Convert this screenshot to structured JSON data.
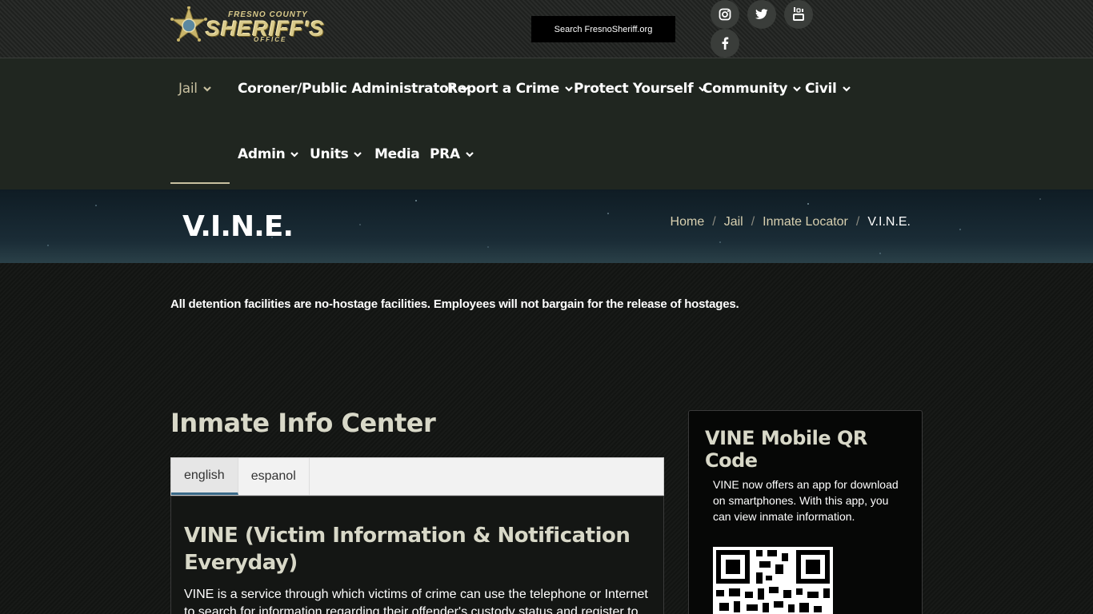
{
  "header": {
    "logo": {
      "line1": "FRESNO COUNTY",
      "line2": "SHERIFF'S",
      "line3": "OFFICE"
    },
    "search_label": "Search FresnoSheriff.org",
    "social": [
      "instagram-icon",
      "twitter-icon",
      "youtube-icon",
      "facebook-icon"
    ]
  },
  "nav": {
    "items": [
      {
        "label": "Jail"
      },
      {
        "label": "Coroner/Public Administrator"
      },
      {
        "label": "Report a Crime"
      },
      {
        "label": "Protect Yourself"
      },
      {
        "label": "Community"
      },
      {
        "label": "Civil"
      },
      {
        "label": "Admin"
      },
      {
        "label": "Units"
      },
      {
        "label": "Media"
      },
      {
        "label": "PRA"
      }
    ]
  },
  "banner": {
    "title": "V.I.N.E.",
    "breadcrumb": [
      "Home",
      "Jail",
      "Inmate Locator",
      "V.I.N.E."
    ]
  },
  "main": {
    "notice": "All detention facilities are no-hostage facilities. Employees will not bargain for the release of hostages.",
    "section_title": "Inmate Info Center",
    "tabs": [
      {
        "label": "english"
      },
      {
        "label": "espanol"
      }
    ],
    "vine_title": "VINE (Victim Information & Notification Everyday)",
    "vine_text": "VINE is a service through which victims of crime can use the telephone or Internet to search for information regarding their offender's custody status and register to"
  },
  "sidebar": {
    "title": "VINE Mobile QR Code",
    "text": "VINE now offers an app for download on smartphones. With this app, you can view inmate information."
  },
  "colors": {
    "accent": "#c8c0a0",
    "tab_underline": "#3a6a88",
    "logo_gold": "#d8c98a"
  }
}
